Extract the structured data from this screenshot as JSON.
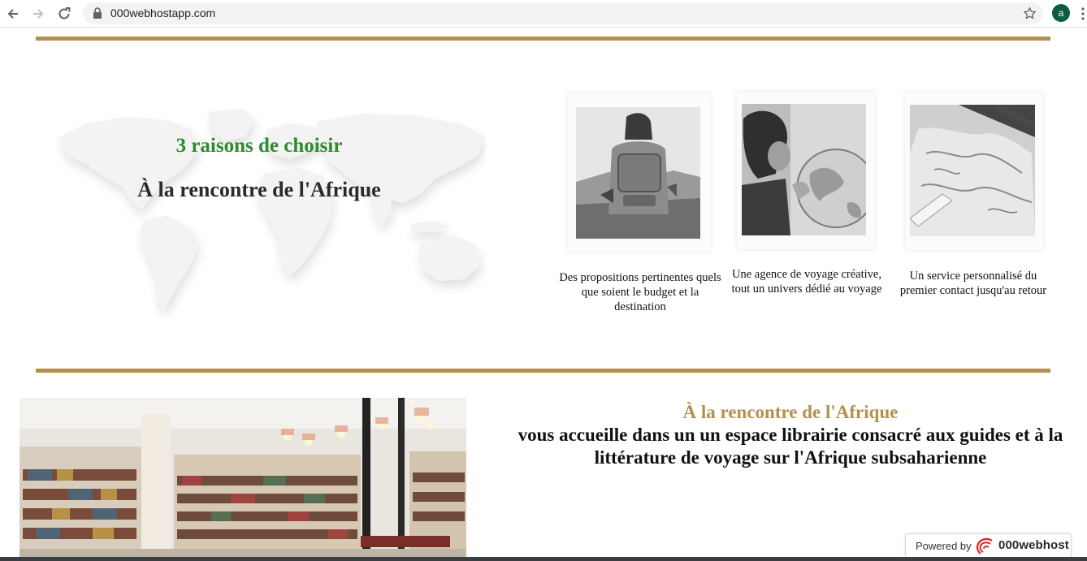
{
  "browser": {
    "url": "000webhostapp.com",
    "profile_initial": "a",
    "icons": [
      "back-arrow-icon",
      "forward-arrow-icon",
      "reload-icon",
      "lock-icon",
      "star-icon",
      "kebab-menu-icon"
    ]
  },
  "colors": {
    "gold_rule": "#b3914d",
    "reasons_title": "#2e8b2e",
    "welcome_title": "#b3914d",
    "profile_avatar": "#0d5c3f"
  },
  "reasons": {
    "title": "3 raisons de choisir",
    "subtitle": "À la rencontre de l'Afrique",
    "items": [
      {
        "caption": "Des propositions pertinentes quels que soient le budget et la destination"
      },
      {
        "caption": "Une agence de voyage créative, tout un univers dédié au voyage"
      },
      {
        "caption": "Un service personnalisé du premier contact jusqu'au retour"
      }
    ]
  },
  "welcome": {
    "title": "À la rencontre de l'Afrique",
    "text": "vous accueille dans un un espace librairie consacré aux guides et à la littérature de voyage sur l'Afrique subsaharienne"
  },
  "powered_badge": {
    "label": "Powered by",
    "brand": "000webhost"
  }
}
